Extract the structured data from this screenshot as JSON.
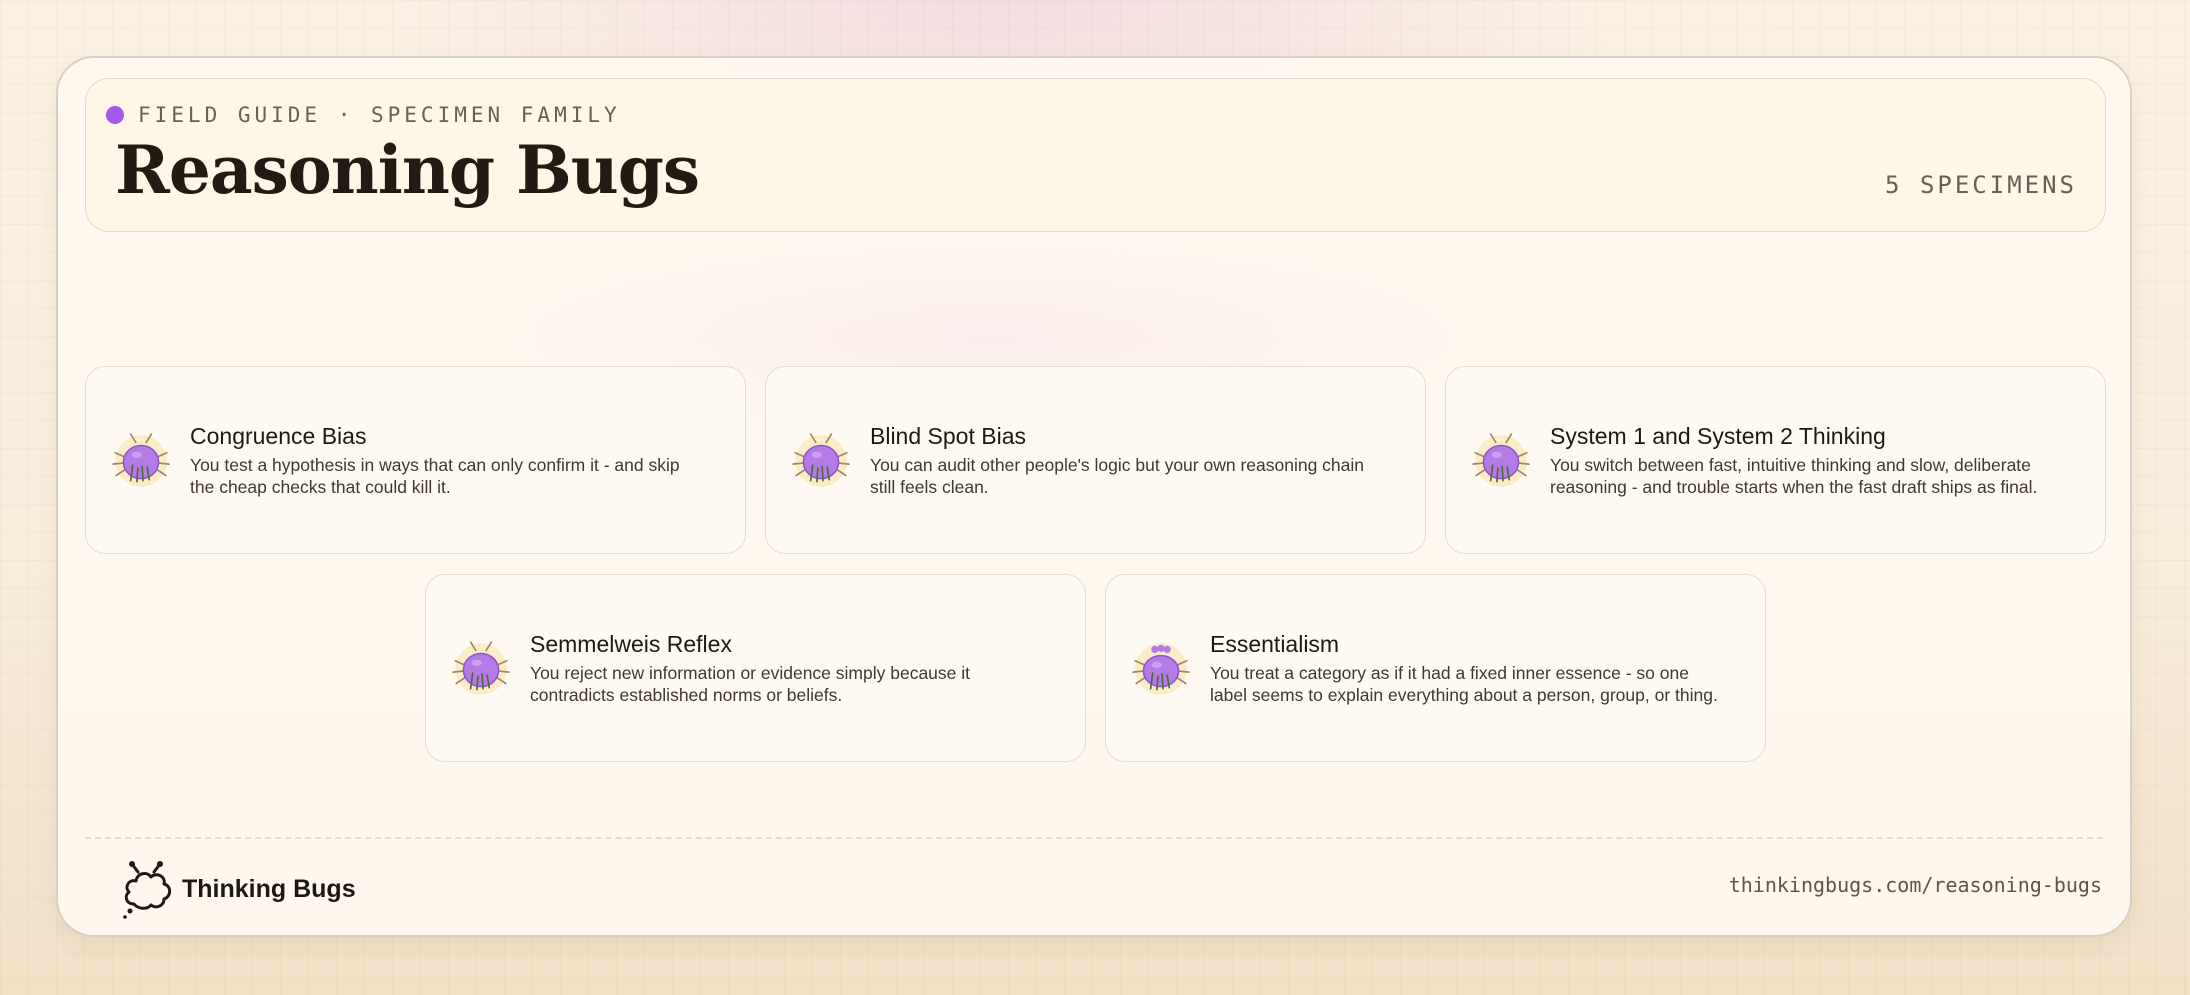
{
  "header": {
    "eyebrow": "FIELD GUIDE · SPECIMEN FAMILY",
    "title": "Reasoning Bugs",
    "count": "5 SPECIMENS"
  },
  "specimens": [
    {
      "title": "Congruence Bias",
      "description": "You test a hypothesis in ways that can only confirm it - and skip the cheap checks that could kill it.",
      "icon": "bug-specimen-icon"
    },
    {
      "title": "Blind Spot Bias",
      "description": "You can audit other people's logic but your own reasoning chain still feels clean.",
      "icon": "bug-specimen-icon"
    },
    {
      "title": "System 1 and System 2 Thinking",
      "description": "You switch between fast, intuitive thinking and slow, deliberate reasoning - and trouble starts when the fast draft ships as final.",
      "icon": "bug-specimen-icon"
    },
    {
      "title": "Semmelweis Reflex",
      "description": "You reject new information or evidence simply because it contradicts established norms or beliefs.",
      "icon": "bug-specimen-icon"
    },
    {
      "title": "Essentialism",
      "description": "You treat a category as if it had a fixed inner essence - so one label seems to explain everything about a person, group, or thing.",
      "icon": "bug-specimen-icon"
    }
  ],
  "footer": {
    "brand": "Thinking Bugs",
    "url": "thinkingbugs.com/reasoning-bugs"
  },
  "colors": {
    "accent": "#a259e8",
    "bug_body": "#b57ae6",
    "text_dark": "#241a14",
    "muted": "#6a5e55"
  }
}
